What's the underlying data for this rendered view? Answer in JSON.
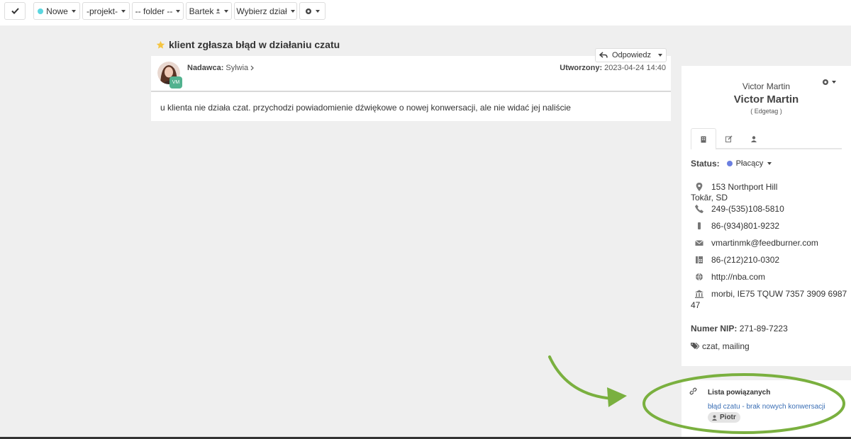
{
  "toolbar": {
    "status_label": "Nowe",
    "status_color": "#5bd6e0",
    "project_label": "-projekt-",
    "folder_label": "-- folder --",
    "user_label": "Bartek",
    "department_label": "Wybierz dział",
    "icons": [
      "check-icon",
      "person-icon",
      "gear-icon"
    ]
  },
  "ticket": {
    "title": "klient zgłasza błąd w działaniu czatu",
    "star_color": "#f5c542",
    "reply_label": "Odpowiedz",
    "sender_label": "Nadawca:",
    "sender_name": "Sylwia",
    "created_label": "Utworzony:",
    "created_value": "2023-04-24 14:40",
    "avatar_badge": "VM",
    "body": "u klienta nie działa czat. przychodzi powiadomienie dźwiękowe o nowej konwersacji, ale nie widać jej naliście"
  },
  "contact": {
    "name_small": "Victor Martin",
    "name_large": "Victor Martin",
    "company": "( Edgetag )",
    "tabs": [
      "building-icon",
      "edit-icon",
      "person-icon"
    ],
    "status_label": "Status:",
    "status_value": "Płacący",
    "status_color": "#6b7fe0",
    "address_line1": "153 Northport Hill",
    "address_line2": "Tokār, SD",
    "phone": "249-(535)108-5810",
    "mobile": "86-(934)801-9232",
    "email": "vmartinmk@feedburner.com",
    "fax": "86-(212)210-0302",
    "website": "http://nba.com",
    "bank_line1": "morbi, IE75 TQUW 7357 3909 6987",
    "bank_line2": "47",
    "nip_label": "Numer NIP:",
    "nip_value": "271-89-7223",
    "tags": "czat, mailing"
  },
  "related": {
    "title": "Lista powiązanych",
    "link": "błąd czatu - brak nowych konwersacji",
    "user": "Piotr"
  },
  "annotation": {
    "color": "#7ab03f"
  }
}
